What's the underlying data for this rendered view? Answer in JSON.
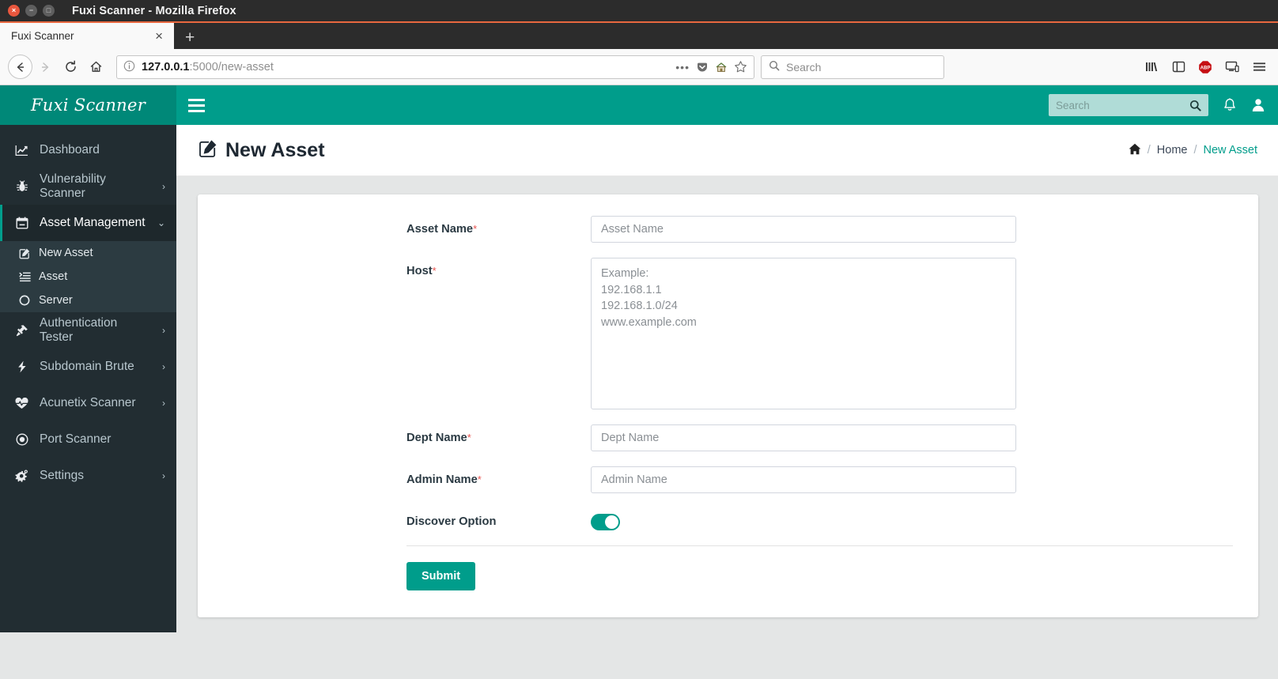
{
  "browser": {
    "window_title": "Fuxi Scanner - Mozilla Firefox",
    "window_controls": {
      "close": "×",
      "minimize": "−",
      "maximize": "□"
    },
    "tab": {
      "label": "Fuxi Scanner",
      "close": "×"
    },
    "new_tab": "+",
    "nav": {
      "back": "←",
      "forward": "→",
      "reload": "↻",
      "home": "⌂"
    },
    "url": {
      "identity_icon": "info-icon",
      "host": "127.0.0.1",
      "path": ":5000/new-asset",
      "full": "127.0.0.1:5000/new-asset"
    },
    "url_actions": {
      "page_actions": "•••",
      "pocket": "pocket-icon",
      "home_page": "home-icon",
      "bookmark": "☆"
    },
    "search": {
      "placeholder": "Search",
      "icon": "search-icon"
    },
    "toolbar_icons": [
      "library-icon",
      "sidebar-icon",
      "adblock-plus-icon",
      "sync-devices-icon",
      "menu-icon"
    ],
    "adblock_label": "ABP",
    "app_menu": "☰"
  },
  "app": {
    "brand": "Fuxi Scanner",
    "hamburger": "menu-toggle-icon",
    "navbar_search": {
      "placeholder": "Search",
      "button_icon": "search-icon"
    },
    "navbar_icons": {
      "notifications": "bell-icon",
      "user": "user-icon"
    }
  },
  "sidebar": {
    "items": [
      {
        "label": "Dashboard",
        "icon": "chart-line-icon",
        "arrow": "",
        "active": false
      },
      {
        "label": "Vulnerability Scanner",
        "icon": "bug-icon",
        "arrow": "›",
        "active": false
      },
      {
        "label": "Asset Management",
        "icon": "calendar-minus-icon",
        "arrow": "⌄",
        "active": true
      },
      {
        "label": "Authentication Tester",
        "icon": "hammer-icon",
        "arrow": "›",
        "active": false
      },
      {
        "label": "Subdomain Brute",
        "icon": "bolt-icon",
        "arrow": "›",
        "active": false
      },
      {
        "label": "Acunetix Scanner",
        "icon": "heartbeat-icon",
        "arrow": "›",
        "active": false
      },
      {
        "label": "Port Scanner",
        "icon": "dot-circle-icon",
        "arrow": "",
        "active": false
      },
      {
        "label": "Settings",
        "icon": "cogs-icon",
        "arrow": "›",
        "active": false
      }
    ],
    "submenu": [
      {
        "label": "New Asset",
        "icon": "pencil-square-icon"
      },
      {
        "label": "Asset",
        "icon": "list-icon"
      },
      {
        "label": "Server",
        "icon": "circle-o-icon"
      }
    ]
  },
  "page": {
    "title": "New Asset",
    "title_icon": "pencil-square-icon",
    "breadcrumb": {
      "home_icon": "home-icon",
      "sep": "/",
      "home": "Home",
      "current": "New Asset"
    }
  },
  "form": {
    "fields": [
      {
        "label": "Asset Name",
        "required": "*",
        "placeholder": "Asset Name",
        "type": "text"
      },
      {
        "label": "Host",
        "required": "*",
        "placeholder": "Example:\n192.168.1.1\n192.168.1.0/24\nwww.example.com",
        "type": "textarea"
      },
      {
        "label": "Dept Name",
        "required": "*",
        "placeholder": "Dept Name",
        "type": "text"
      },
      {
        "label": "Admin Name",
        "required": "*",
        "placeholder": "Admin Name",
        "type": "text"
      },
      {
        "label": "Discover Option",
        "required": "",
        "type": "toggle",
        "value": "on"
      }
    ],
    "submit_label": "Submit"
  },
  "colors": {
    "teal": "#009d8b",
    "teal_dark": "#008878",
    "sidebar": "#222d32",
    "sidebar_active": "#1e282c",
    "submenu": "#2c3b41",
    "content_bg": "#e4e6e6",
    "required_red": "#e8534f",
    "firefox_accent": "#e8683f"
  }
}
